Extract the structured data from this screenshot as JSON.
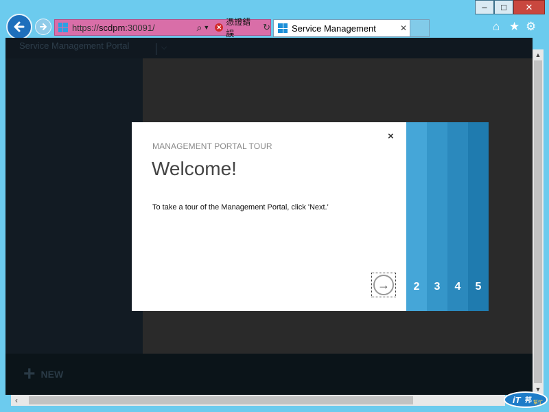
{
  "window": {
    "minimize": "–",
    "maximize": "□",
    "close": "✕"
  },
  "nav": {
    "back_icon": "back-arrow-icon",
    "forward_icon": "forward-arrow-icon",
    "address_url_scheme": "https://",
    "address_url_host": "scdpm",
    "address_url_port": ":30091/",
    "cert_error_text": "憑證錯誤",
    "home_icon": "home-icon",
    "favorites_icon": "star-icon",
    "settings_icon": "gear-icon"
  },
  "tab": {
    "title": "Service Management",
    "close": "✕"
  },
  "portal": {
    "title": "Service Management Portal",
    "new_label": "NEW"
  },
  "dialog": {
    "heading": "MANAGEMENT PORTAL TOUR",
    "title": "Welcome!",
    "body": "To take a tour of the Management Portal, click 'Next.'",
    "close": "×",
    "steps": [
      "2",
      "3",
      "4",
      "5"
    ]
  },
  "colors": {
    "frame": "#6ccbee",
    "step_2": "#45a6d8",
    "step_3": "#3596c9",
    "step_4": "#2b89bd",
    "step_5": "#1f7baf"
  }
}
